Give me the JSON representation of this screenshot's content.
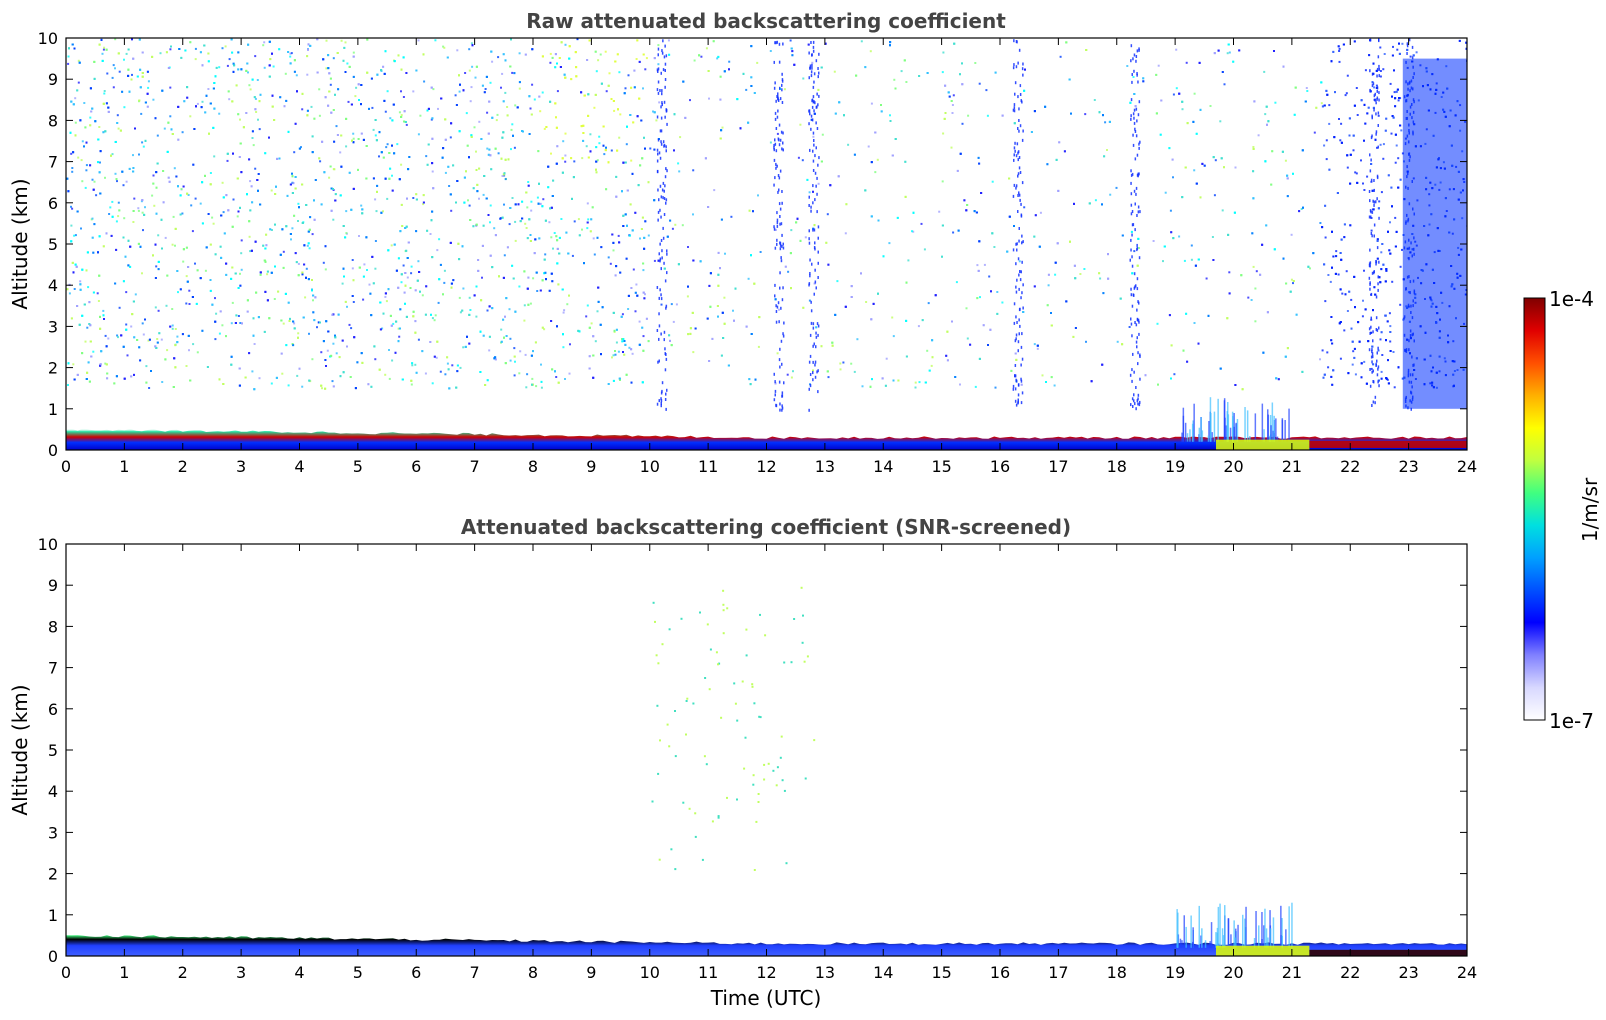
{
  "chart_data": [
    {
      "type": "heatmap",
      "title": "Raw attenuated backscattering coefficient",
      "xlabel": "",
      "ylabel": "Altitude (km)",
      "xlim": [
        0,
        24
      ],
      "ylim": [
        0,
        10
      ],
      "xticks": [
        "0",
        "1",
        "2",
        "3",
        "4",
        "5",
        "6",
        "7",
        "8",
        "9",
        "10",
        "11",
        "12",
        "13",
        "14",
        "15",
        "16",
        "17",
        "18",
        "19",
        "20",
        "21",
        "22",
        "23",
        "24"
      ],
      "yticks": [
        "0",
        "1",
        "2",
        "3",
        "4",
        "5",
        "6",
        "7",
        "8",
        "9",
        "10"
      ],
      "features": {
        "surface_layer_top_km": [
          [
            0,
            0.5
          ],
          [
            6,
            0.4
          ],
          [
            12,
            0.3
          ],
          [
            18,
            0.3
          ],
          [
            24,
            0.3
          ]
        ],
        "noise_cloud_region": "altitude 1.5-10 km, strongest 0-10 UTC and 21.5-24 UTC",
        "vertical_streaks_utc": [
          10.2,
          12.2,
          12.8,
          16.3,
          18.3,
          22.4,
          23.0
        ]
      }
    },
    {
      "type": "heatmap",
      "title": "Attenuated backscattering coefficient (SNR-screened)",
      "xlabel": "Time (UTC)",
      "ylabel": "Altitude (km)",
      "xlim": [
        0,
        24
      ],
      "ylim": [
        0,
        10
      ],
      "xticks": [
        "0",
        "1",
        "2",
        "3",
        "4",
        "5",
        "6",
        "7",
        "8",
        "9",
        "10",
        "11",
        "12",
        "13",
        "14",
        "15",
        "16",
        "17",
        "18",
        "19",
        "20",
        "21",
        "22",
        "23",
        "24"
      ],
      "yticks": [
        "0",
        "1",
        "2",
        "3",
        "4",
        "5",
        "6",
        "7",
        "8",
        "9",
        "10"
      ],
      "features": {
        "surface_layer_top_km": [
          [
            0,
            0.5
          ],
          [
            6,
            0.4
          ],
          [
            12,
            0.3
          ],
          [
            18,
            0.3
          ],
          [
            24,
            0.3
          ]
        ],
        "sparse_points_utc_range": [
          10,
          12.8
        ]
      }
    }
  ],
  "colorbar": {
    "label": "1/m/sr",
    "max_label": "1e-4",
    "min_label": "1e-7",
    "colors": [
      "#ffffff",
      "#d8d8ff",
      "#8080ff",
      "#0000ff",
      "#0050ff",
      "#00a0ff",
      "#00e0e0",
      "#40ff80",
      "#c0ff40",
      "#ffff00",
      "#ffb000",
      "#ff5000",
      "#e00000",
      "#800000"
    ]
  }
}
